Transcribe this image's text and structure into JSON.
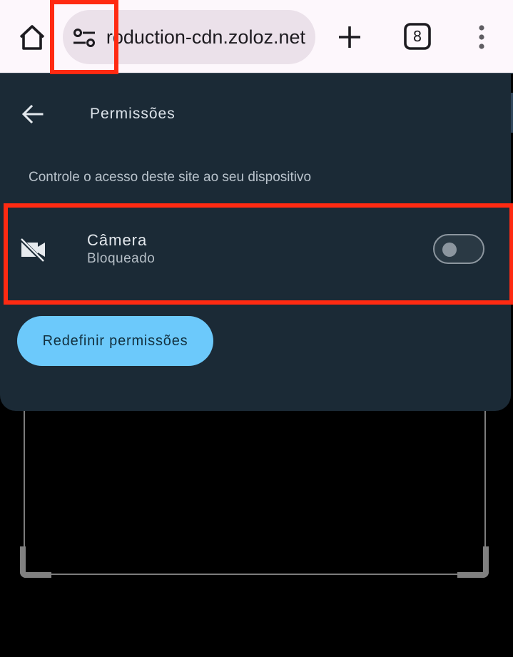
{
  "toolbar": {
    "url": "production-cdn.zoloz.net",
    "tab_count": "8"
  },
  "panel": {
    "title": "Permissões",
    "subtitle": "Controle o acesso deste site ao seu dispositivo",
    "permissions": [
      {
        "name": "Câmera",
        "status": "Bloqueado",
        "enabled": false,
        "icon": "camera-off-icon"
      }
    ],
    "reset_button": "Redefinir permissões"
  },
  "colors": {
    "toolbar_bg": "#fdf7fc",
    "url_pill_bg": "#ebe1ea",
    "panel_bg": "#1b2a36",
    "accent_button": "#6cc9fb",
    "annotation_box": "#ff2a12"
  }
}
